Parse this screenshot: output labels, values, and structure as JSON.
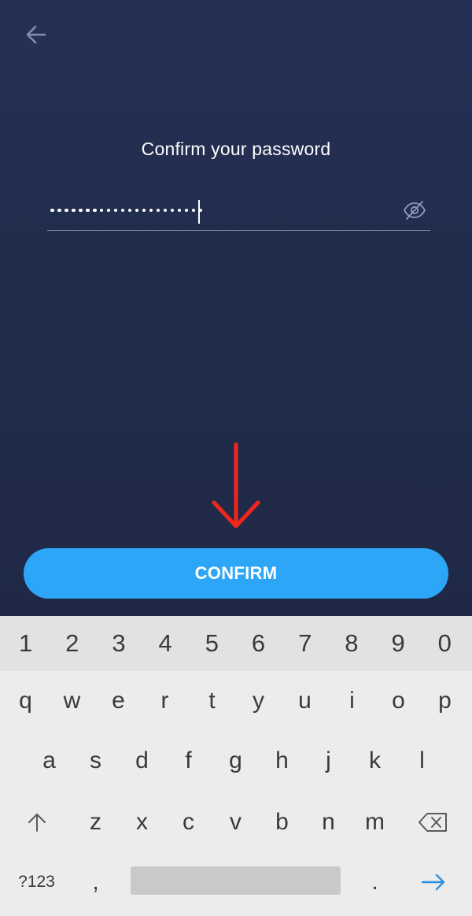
{
  "screen": {
    "title": "Confirm your password",
    "password_mask": "••••••••••••••••••••••",
    "confirm_label": "CONFIRM"
  },
  "icons": {
    "back": "arrow-left-icon",
    "visibility": "eye-off-icon",
    "annotation": "red-down-arrow-icon",
    "shift": "shift-arrow-icon",
    "backspace": "backspace-icon",
    "enter": "enter-arrow-icon"
  },
  "colors": {
    "background": "#223050",
    "button": "#2ea6f7",
    "annotation_arrow": "#f0261c",
    "keyboard_bg": "#ececec",
    "number_row_bg": "#e2e2e2"
  },
  "keyboard": {
    "numbers": [
      "1",
      "2",
      "3",
      "4",
      "5",
      "6",
      "7",
      "8",
      "9",
      "0"
    ],
    "row1": [
      "q",
      "w",
      "e",
      "r",
      "t",
      "y",
      "u",
      "i",
      "o",
      "p"
    ],
    "row2": [
      "a",
      "s",
      "d",
      "f",
      "g",
      "h",
      "j",
      "k",
      "l"
    ],
    "row3": [
      "z",
      "x",
      "c",
      "v",
      "b",
      "n",
      "m"
    ],
    "symbols_label": "?123",
    "comma": ",",
    "period": "."
  }
}
